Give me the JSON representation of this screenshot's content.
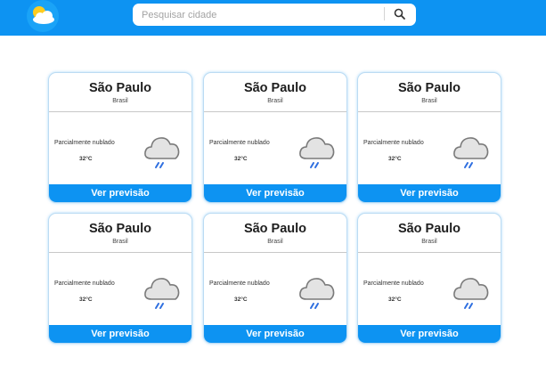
{
  "header": {
    "logo_icon": "sun-cloud-logo-icon",
    "search": {
      "placeholder": "Pesquisar cidade",
      "value": "",
      "button_icon": "search-icon"
    }
  },
  "colors": {
    "brand": "#0d93f2",
    "header_bg": "#0d93f2",
    "button_bg": "#0d93f2",
    "card_border": "#bcdcf3"
  },
  "cards": [
    {
      "city": "São Paulo",
      "country": "Brasil",
      "description": "Parcialmente nublado",
      "temperature": "32°C",
      "icon": "cloud-rain-icon",
      "button_label": "Ver previsão"
    },
    {
      "city": "São Paulo",
      "country": "Brasil",
      "description": "Parcialmente nublado",
      "temperature": "32°C",
      "icon": "cloud-rain-icon",
      "button_label": "Ver previsão"
    },
    {
      "city": "São Paulo",
      "country": "Brasil",
      "description": "Parcialmente nublado",
      "temperature": "32°C",
      "icon": "cloud-rain-icon",
      "button_label": "Ver previsão"
    },
    {
      "city": "São Paulo",
      "country": "Brasil",
      "description": "Parcialmente nublado",
      "temperature": "32°C",
      "icon": "cloud-rain-icon",
      "button_label": "Ver previsão"
    },
    {
      "city": "São Paulo",
      "country": "Brasil",
      "description": "Parcialmente nublado",
      "temperature": "32°C",
      "icon": "cloud-rain-icon",
      "button_label": "Ver previsão"
    },
    {
      "city": "São Paulo",
      "country": "Brasil",
      "description": "Parcialmente nublado",
      "temperature": "32°C",
      "icon": "cloud-rain-icon",
      "button_label": "Ver previsão"
    }
  ]
}
